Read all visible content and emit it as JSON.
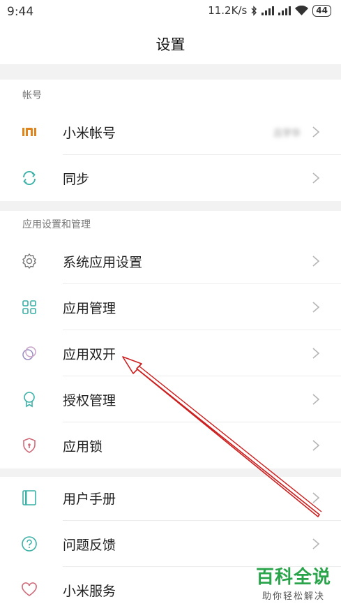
{
  "status": {
    "time": "9:44",
    "speed": "11.2K/s",
    "battery": "44"
  },
  "header": {
    "title": "设置"
  },
  "sections": [
    {
      "title": "帐号",
      "items": [
        {
          "label": "小米帐号",
          "value": "吕学华",
          "icon": "mi-logo-icon"
        },
        {
          "label": "同步",
          "icon": "sync-icon"
        }
      ]
    },
    {
      "title": "应用设置和管理",
      "items": [
        {
          "label": "系统应用设置",
          "icon": "gear-icon"
        },
        {
          "label": "应用管理",
          "icon": "grid-icon"
        },
        {
          "label": "应用双开",
          "icon": "dual-circle-icon"
        },
        {
          "label": "授权管理",
          "icon": "badge-icon"
        },
        {
          "label": "应用锁",
          "icon": "shield-lock-icon"
        }
      ]
    },
    {
      "title": "",
      "items": [
        {
          "label": "用户手册",
          "icon": "book-icon"
        },
        {
          "label": "问题反馈",
          "icon": "question-icon"
        },
        {
          "label": "小米服务",
          "icon": "heart-icon"
        }
      ]
    }
  ],
  "watermark": {
    "main": "百科全说",
    "sub": "助你轻松解决"
  },
  "colors": {
    "gap": "#f2f2f2",
    "arrow": "#cc1f1f",
    "mi": "#e0841b",
    "teal": "#3ab0a6"
  }
}
